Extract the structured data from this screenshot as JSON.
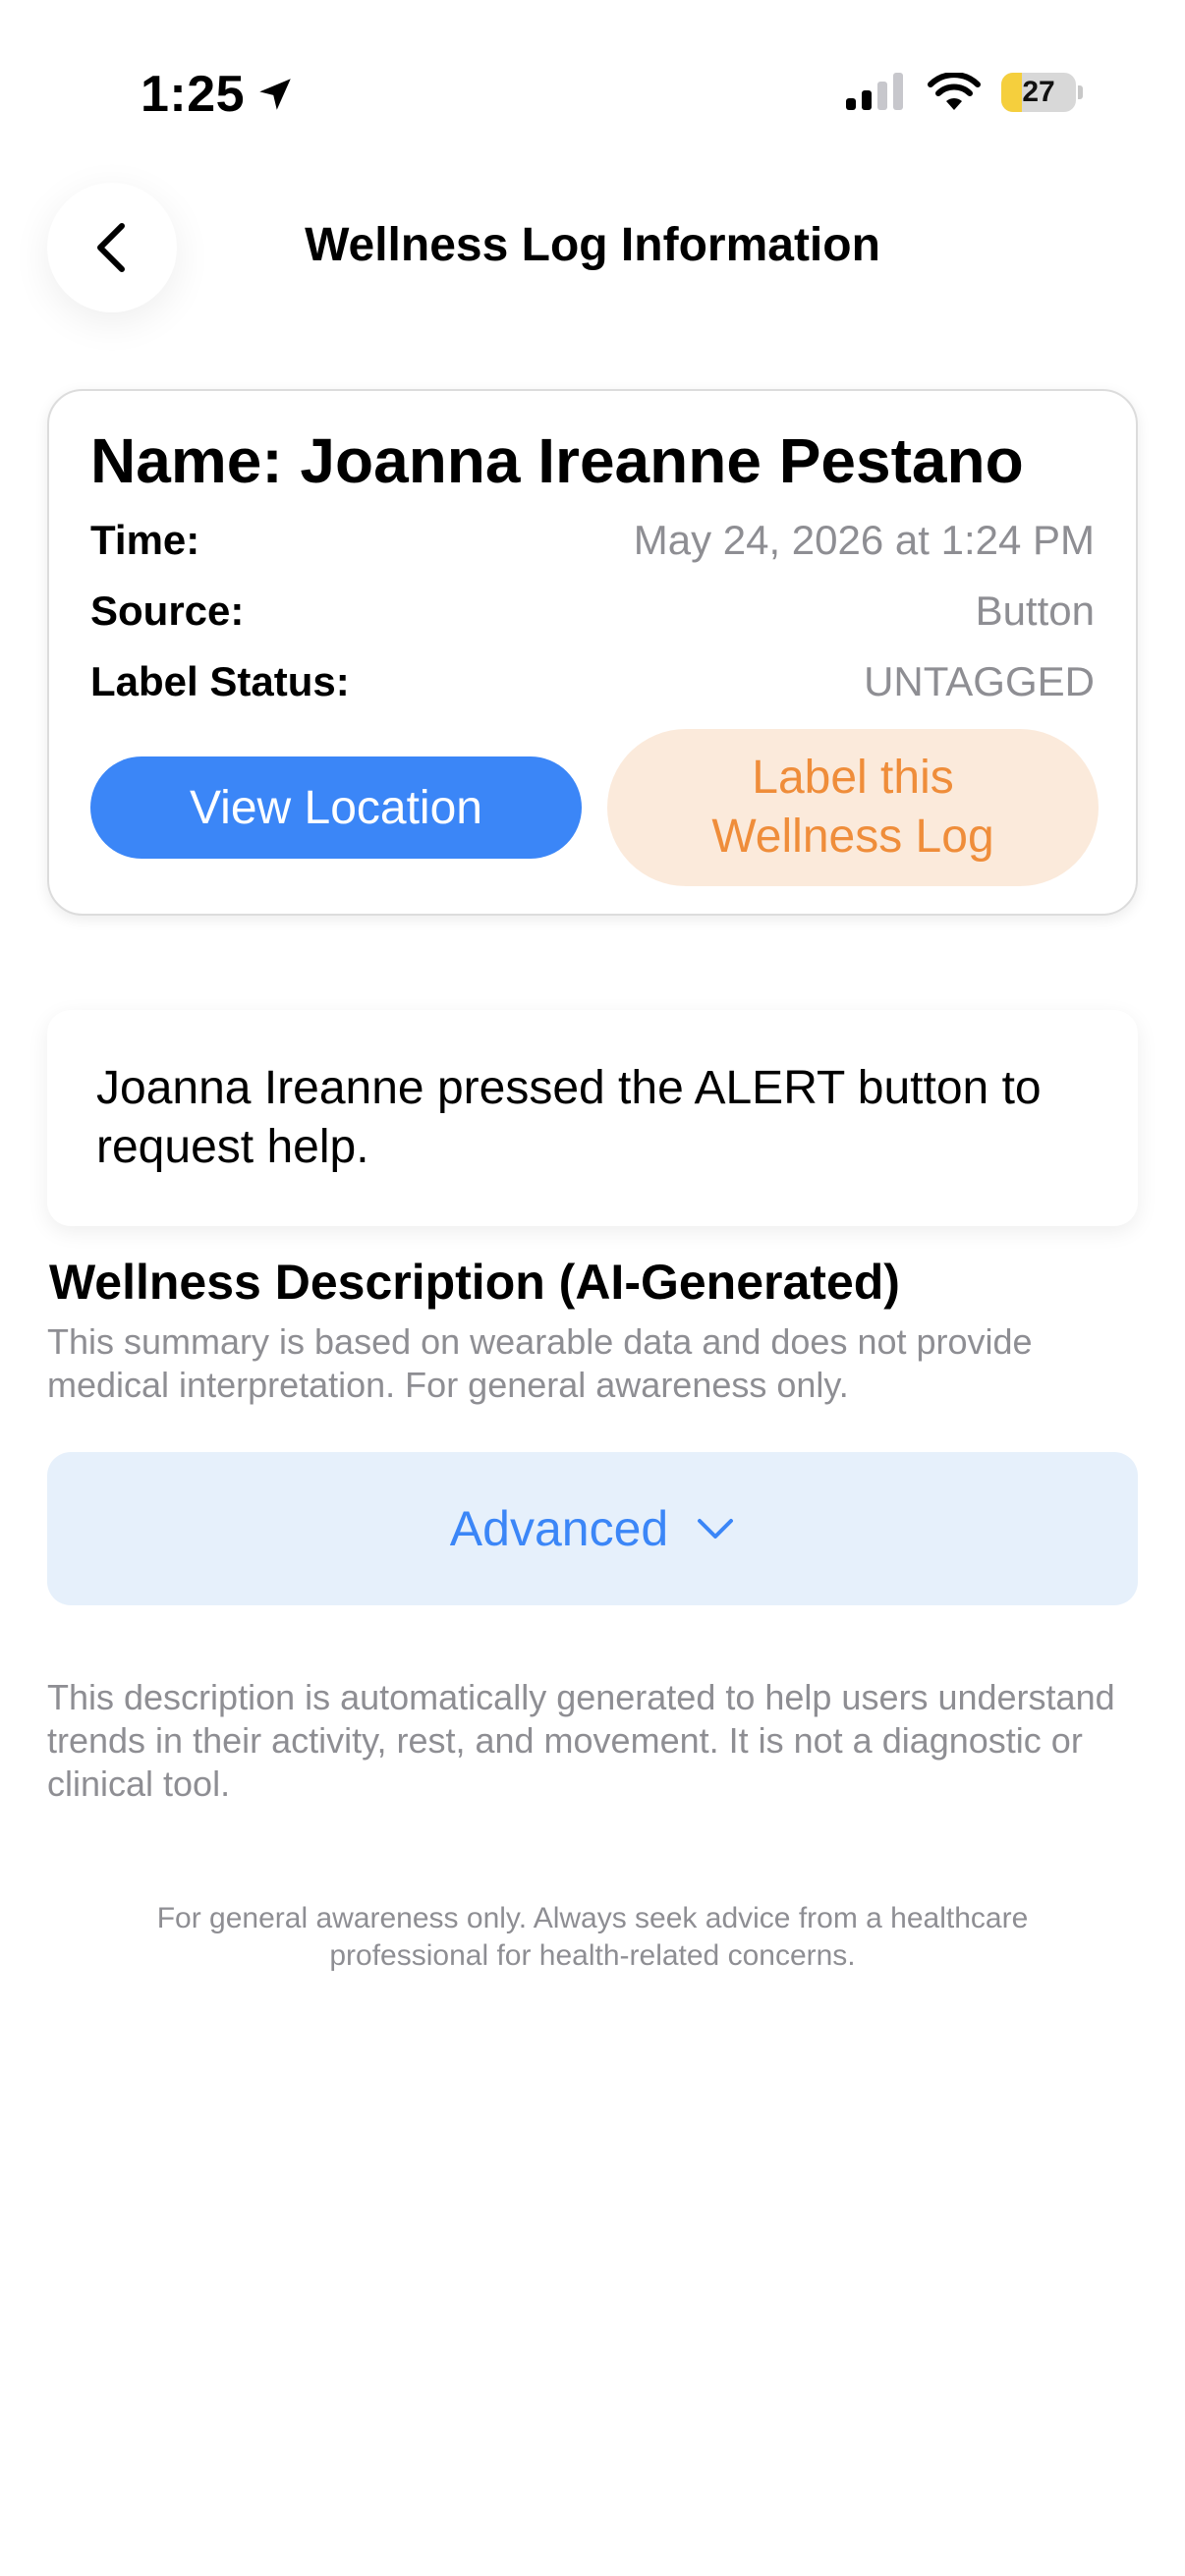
{
  "status_bar": {
    "time": "1:25",
    "battery_level": "27",
    "battery_fraction": 0.27,
    "icons": [
      "location-arrow-icon",
      "cellular-signal-icon",
      "wifi-icon",
      "battery-icon"
    ]
  },
  "nav": {
    "title": "Wellness Log Information",
    "back_icon": "chevron-left-icon"
  },
  "log": {
    "name": "Name: Joanna Ireanne Pestano",
    "rows": [
      {
        "label": "Time:",
        "value": "May 24, 2026 at 1:24 PM"
      },
      {
        "label": "Source:",
        "value": "Button"
      },
      {
        "label": "Label Status:",
        "value": "UNTAGGED"
      }
    ],
    "view_location_label": "View Location",
    "label_log_label": "Label this Wellness Log"
  },
  "alert_message": "Joanna Ireanne pressed the ALERT button to request help.",
  "wellness": {
    "title": "Wellness Description (AI-Generated)",
    "subtitle": "This summary is based on wearable data and does not provide medical interpretation. For general awareness only.",
    "advanced_label": "Advanced",
    "advanced_icon": "chevron-down-icon",
    "description_note": "This description is automatically generated to help users understand trends in their activity, rest, and movement. It is not a diagnostic or clinical tool.",
    "footer_note": "For general awareness only. Always seek advice from a healthcare professional for health-related concerns."
  },
  "colors": {
    "primary_blue": "#3b86f7",
    "label_orange": "#ef8d3a",
    "label_bg": "#fbeadb",
    "advanced_bg": "#e6f0fb",
    "muted_text": "#8e8e93",
    "battery_yellow": "#f5cf3d"
  }
}
